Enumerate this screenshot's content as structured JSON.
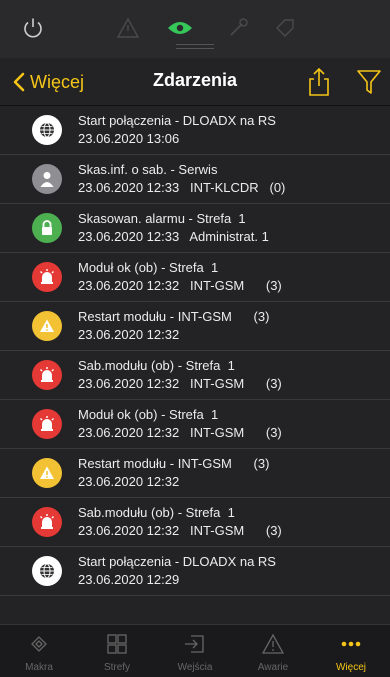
{
  "colors": {
    "accent": "#f5c518",
    "eye": "#35c759",
    "red": "#e53935",
    "green": "#4caf50",
    "yellow": "#f3c234",
    "gray": "#8e8e93",
    "white": "#ffffff"
  },
  "topbar": {
    "icons": [
      "power-icon",
      "warning-icon",
      "eye-icon",
      "wrench-icon",
      "tag-icon"
    ]
  },
  "navbar": {
    "back_label": "Więcej",
    "title": "Zdarzenia",
    "share_icon": "share-icon",
    "filter_icon": "filter-icon"
  },
  "events": [
    {
      "icon": "globe",
      "line1": "Start połączenia - DLOADX na RS",
      "line2": "23.06.2020 13:06"
    },
    {
      "icon": "user",
      "line1": "Skas.inf. o sab. - Serwis",
      "line2": "23.06.2020 12:33   INT-KLCDR   (0)"
    },
    {
      "icon": "lock",
      "line1": "Skasowan. alarmu - Strefa  1",
      "line2": "23.06.2020 12:33   Administrat. 1"
    },
    {
      "icon": "alarm",
      "line1": "Moduł ok (ob) - Strefa  1",
      "line2": "23.06.2020 12:32   INT-GSM      (3)"
    },
    {
      "icon": "warning",
      "line1": "Restart modułu - INT-GSM      (3)",
      "line2": "23.06.2020 12:32"
    },
    {
      "icon": "alarm",
      "line1": "Sab.modułu (ob) - Strefa  1",
      "line2": "23.06.2020 12:32   INT-GSM      (3)"
    },
    {
      "icon": "alarm",
      "line1": "Moduł ok (ob) - Strefa  1",
      "line2": "23.06.2020 12:32   INT-GSM      (3)"
    },
    {
      "icon": "warning",
      "line1": "Restart modułu - INT-GSM      (3)",
      "line2": "23.06.2020 12:32"
    },
    {
      "icon": "alarm",
      "line1": "Sab.modułu (ob) - Strefa  1",
      "line2": "23.06.2020 12:32   INT-GSM      (3)"
    },
    {
      "icon": "globe",
      "line1": "Start połączenia - DLOADX na RS",
      "line2": "23.06.2020 12:29"
    }
  ],
  "tabbar": {
    "active_index": 4,
    "tabs": [
      {
        "label": "Makra",
        "icon": "macros-icon"
      },
      {
        "label": "Strefy",
        "icon": "zones-icon"
      },
      {
        "label": "Wejścia",
        "icon": "inputs-icon"
      },
      {
        "label": "Awarie",
        "icon": "warning-icon"
      },
      {
        "label": "Więcej",
        "icon": "more-icon"
      }
    ]
  }
}
